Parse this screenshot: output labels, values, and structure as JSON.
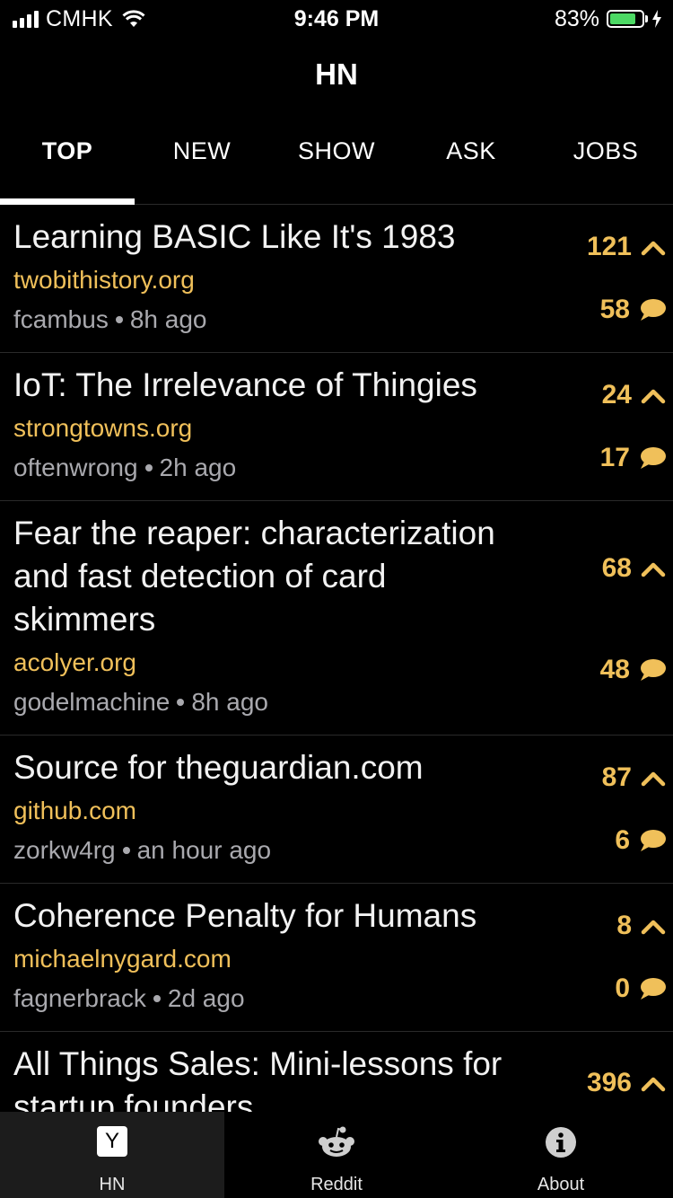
{
  "status_bar": {
    "carrier": "CMHK",
    "time": "9:46 PM",
    "battery_percent": "83%",
    "battery_level": 0.83,
    "battery_color": "#4cd964"
  },
  "header": {
    "title": "HN"
  },
  "tabs": [
    {
      "label": "TOP",
      "active": true
    },
    {
      "label": "NEW",
      "active": false
    },
    {
      "label": "SHOW",
      "active": false
    },
    {
      "label": "ASK",
      "active": false
    },
    {
      "label": "JOBS",
      "active": false
    }
  ],
  "stories": [
    {
      "title": "Learning BASIC Like It's 1983",
      "domain": "twobithistory.org",
      "author": "fcambus",
      "age": "8h ago",
      "points": "121",
      "comments": "58"
    },
    {
      "title": "IoT: The Irrelevance of Thingies",
      "domain": "strongtowns.org",
      "author": "oftenwrong",
      "age": "2h ago",
      "points": "24",
      "comments": "17"
    },
    {
      "title": "Fear the reaper: characterization and fast detection of card skimmers",
      "domain": "acolyer.org",
      "author": "godelmachine",
      "age": "8h ago",
      "points": "68",
      "comments": "48"
    },
    {
      "title": "Source for theguardian.com",
      "domain": "github.com",
      "author": "zorkw4rg",
      "age": "an hour ago",
      "points": "87",
      "comments": "6"
    },
    {
      "title": "Coherence Penalty for Humans",
      "domain": "michaelnygard.com",
      "author": "fagnerbrack",
      "age": "2d ago",
      "points": "8",
      "comments": "0"
    },
    {
      "title": "All Things Sales: Mini-lessons for startup founders",
      "domain": "",
      "author": "",
      "age": "",
      "points": "396",
      "comments": ""
    }
  ],
  "tabbar": {
    "items": [
      {
        "label": "HN",
        "icon": "y-combinator-icon",
        "icon_text": "Y",
        "active": true
      },
      {
        "label": "Reddit",
        "icon": "reddit-icon",
        "active": false
      },
      {
        "label": "About",
        "icon": "info-icon",
        "active": false
      }
    ]
  },
  "colors": {
    "accent": "#f0c05a",
    "meta": "#a9a9ae",
    "background": "#000000"
  }
}
